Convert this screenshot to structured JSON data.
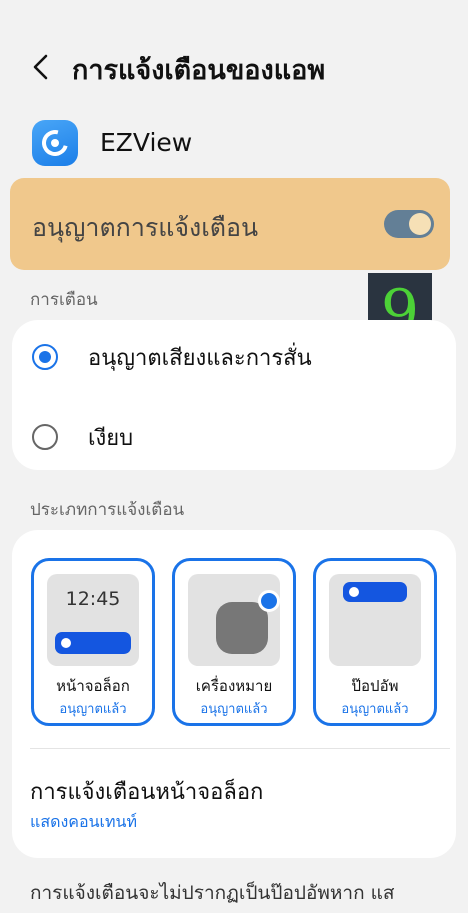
{
  "header": {
    "title": "การแจ้งเตือนของแอพ"
  },
  "app": {
    "name": "EZView"
  },
  "allow": {
    "label": "อนุญาตการแจ้งเตือน",
    "enabled": true
  },
  "badge_number": "9",
  "alerts": {
    "section_label": "การเตือน",
    "options": [
      {
        "label": "อนุญาตเสียงและการสั่น",
        "selected": true
      },
      {
        "label": "เงียบ",
        "selected": false
      }
    ]
  },
  "types": {
    "section_label": "ประเภทการแจ้งเตือน",
    "items": [
      {
        "name": "หน้าจอล็อก",
        "status": "อนุญาตแล้ว",
        "preview_text": "12:45"
      },
      {
        "name": "เครื่องหมาย",
        "status": "อนุญาตแล้ว"
      },
      {
        "name": "ป๊อปอัพ",
        "status": "อนุญาตแล้ว"
      }
    ]
  },
  "lockscreen": {
    "title": "การแจ้งเตือนหน้าจอล็อก",
    "value": "แสดงคอนเทนท์"
  },
  "bottom_note": "การแจ้งเตือนจะไม่ปรากฏเป็นป๊อปอัพหาก แส",
  "colors": {
    "accent": "#1a73e8",
    "highlight": "#f0c88c",
    "toggle_track": "#637f96"
  }
}
